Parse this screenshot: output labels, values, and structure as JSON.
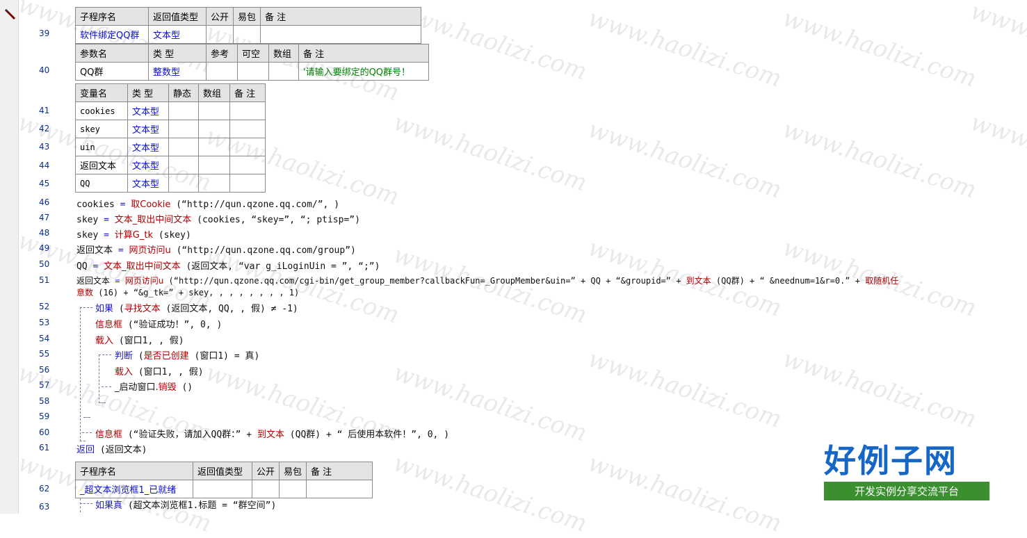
{
  "line_numbers": [
    "39",
    "40",
    "41",
    "42",
    "43",
    "44",
    "45",
    "46",
    "47",
    "48",
    "49",
    "50",
    "51",
    "52",
    "53",
    "54",
    "55",
    "56",
    "57",
    "58",
    "59",
    "60",
    "61",
    "62",
    "63"
  ],
  "sub_table_1": {
    "headers": [
      "子程序名",
      "返回值类型",
      "公开",
      "易包",
      "备 注"
    ],
    "row": [
      "软件绑定QQ群",
      "文本型",
      "",
      "",
      ""
    ]
  },
  "param_table": {
    "headers": [
      "参数名",
      "类 型",
      "参考",
      "可空",
      "数组",
      "备 注"
    ],
    "row": [
      "QQ群",
      "整数型",
      "",
      "",
      "",
      "'请输入要绑定的QQ群号！"
    ]
  },
  "var_table": {
    "headers": [
      "变量名",
      "类 型",
      "静态",
      "数组",
      "备 注"
    ],
    "rows": [
      [
        "cookies",
        "文本型"
      ],
      [
        "skey",
        "文本型"
      ],
      [
        "uin",
        "文本型"
      ],
      [
        "返回文本",
        "文本型"
      ],
      [
        "QQ",
        "文本型"
      ]
    ]
  },
  "code": {
    "l46": {
      "a": "cookies",
      "b": " = ",
      "c": "取Cookie",
      "d": " (“http://qun.qzone.qq.com/”, )"
    },
    "l47": {
      "a": "skey",
      "b": " = ",
      "c": "文本_取出中间文本",
      "d": " (cookies, “skey=”, “; ptisp=”)"
    },
    "l48": {
      "a": "skey",
      "b": " = ",
      "c": "计算G_tk",
      "d": " (skey)"
    },
    "l49": {
      "a": "返回文本",
      "b": " = ",
      "c": "网页访问u",
      "d": " (“http://qun.qzone.qq.com/group”)"
    },
    "l50": {
      "a": "QQ",
      "b": " = ",
      "c": "文本_取出中间文本",
      "d": " (返回文本, “var g_iLoginUin = ”, “;”)"
    },
    "l51a": {
      "a": "返回文本",
      "b": " = ",
      "c": "网页访问u",
      "d": " (“http://qun.qzone.qq.com/cgi-bin/get_group_member?callbackFun=_GroupMember&uin=” + QQ + “&groupid=” + ",
      "e": "到文本",
      "f": " (QQ群) + “ &neednum=1&r=0.” + ",
      "g": "取随机任"
    },
    "l51b": {
      "a": "意数",
      "b": " (16) + “&g_tk=” + skey, , , , , , , , 1)"
    },
    "l52": {
      "a": "如果",
      "b": " (",
      "c": "寻找文本",
      "d": " (返回文本, QQ, , 假) ≠ -1)"
    },
    "l53": {
      "a": "信息框",
      "b": " (“验证成功！”, 0, )"
    },
    "l54": {
      "a": "载入",
      "b": " (窗口1, , 假)"
    },
    "l55": {
      "a": "判断",
      "b": " (",
      "c": "是否已创建",
      "d": " (窗口1) = 真)"
    },
    "l56": {
      "a": "载入",
      "b": " (窗口1, , 假)"
    },
    "l57": {
      "a": "_启动窗口.",
      "b": "销毁",
      "c": " ()"
    },
    "l60": {
      "a": "信息框",
      "b": " (“验证失败，请加入QQ群：” + ",
      "c": "到文本",
      "d": " (QQ群) + “ 后使用本软件！”, 0, )"
    },
    "l61": {
      "a": "返回",
      "b": " (返回文本)"
    },
    "l63": {
      "a": "如果真",
      "b": " (超文本浏览框1.标题 = “群空间”)"
    }
  },
  "sub_table_2": {
    "headers": [
      "子程序名",
      "返回值类型",
      "公开",
      "易包",
      "备 注"
    ],
    "row": [
      "_超文本浏览框1_已就绪",
      "",
      "",
      "",
      ""
    ]
  },
  "watermark": "www.haolizi.com",
  "logo": {
    "main": "好例子网",
    "sub": "开发实例分享交流平台"
  }
}
